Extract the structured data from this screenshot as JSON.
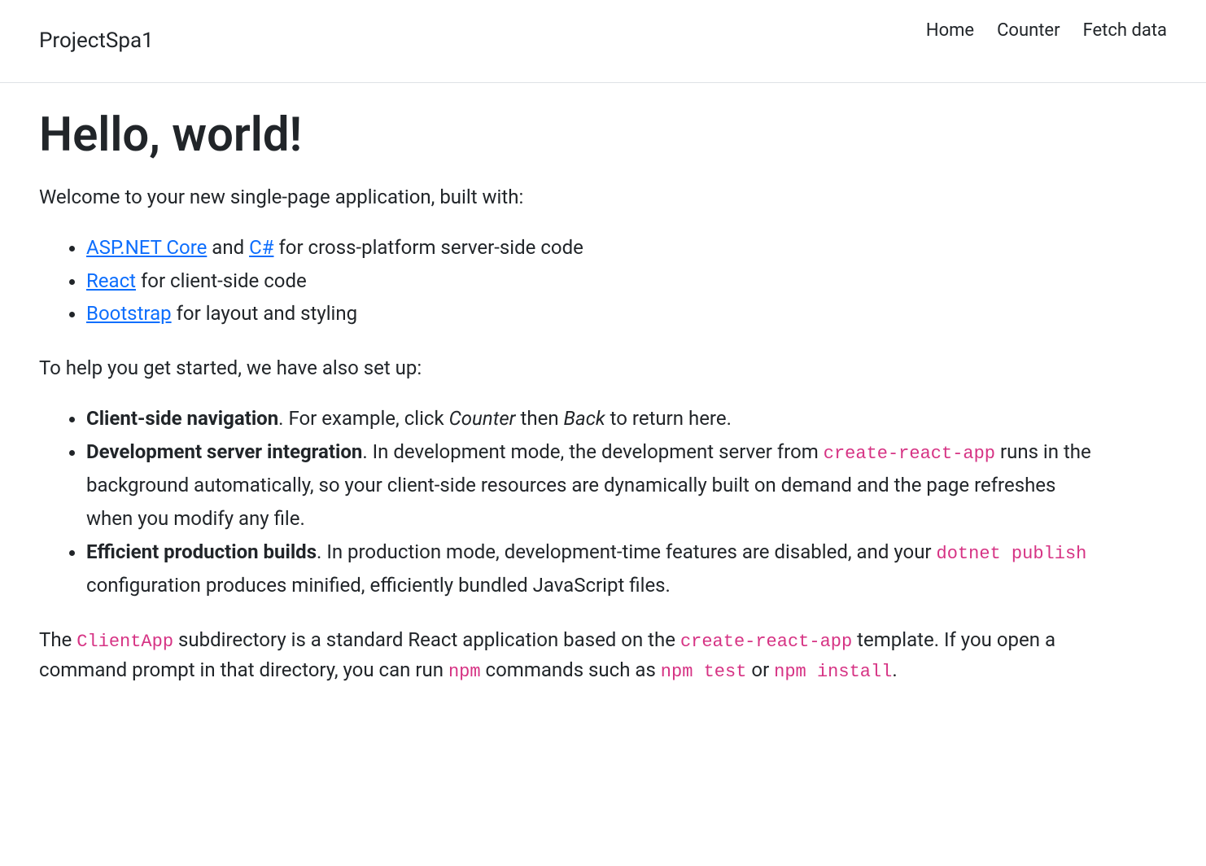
{
  "navbar": {
    "brand": "ProjectSpa1",
    "links": [
      {
        "label": "Home"
      },
      {
        "label": "Counter"
      },
      {
        "label": "Fetch data"
      }
    ]
  },
  "main": {
    "heading": "Hello, world!",
    "welcome": "Welcome to your new single-page application, built with:",
    "tech_list": [
      {
        "link1": "ASP.NET Core",
        "text1": " and ",
        "link2": "C#",
        "text2": " for cross-platform server-side code"
      },
      {
        "link1": "React",
        "text1": " for client-side code"
      },
      {
        "link1": "Bootstrap",
        "text1": " for layout and styling"
      }
    ],
    "setup_intro": "To help you get started, we have also set up:",
    "features": [
      {
        "bold": "Client-side navigation",
        "after_bold": ". For example, click ",
        "em1": "Counter",
        "mid": " then ",
        "em2": "Back",
        "tail": " to return here."
      },
      {
        "bold": "Development server integration",
        "after_bold": ". In development mode, the development server from ",
        "code1": "create-react-app",
        "tail": " runs in the background automatically, so your client-side resources are dynamically built on demand and the page refreshes when you modify any file."
      },
      {
        "bold": "Efficient production builds",
        "after_bold": ". In production mode, development-time features are disabled, and your ",
        "code1": "dotnet publish",
        "tail": " configuration produces minified, efficiently bundled JavaScript files."
      }
    ],
    "closing": {
      "t1": "The ",
      "c1": "ClientApp",
      "t2": " subdirectory is a standard React application based on the ",
      "c2": "create-react-app",
      "t3": " template. If you open a command prompt in that directory, you can run ",
      "c3": "npm",
      "t4": " commands such as ",
      "c4": "npm test",
      "t5": " or ",
      "c5": "npm install",
      "t6": "."
    }
  }
}
